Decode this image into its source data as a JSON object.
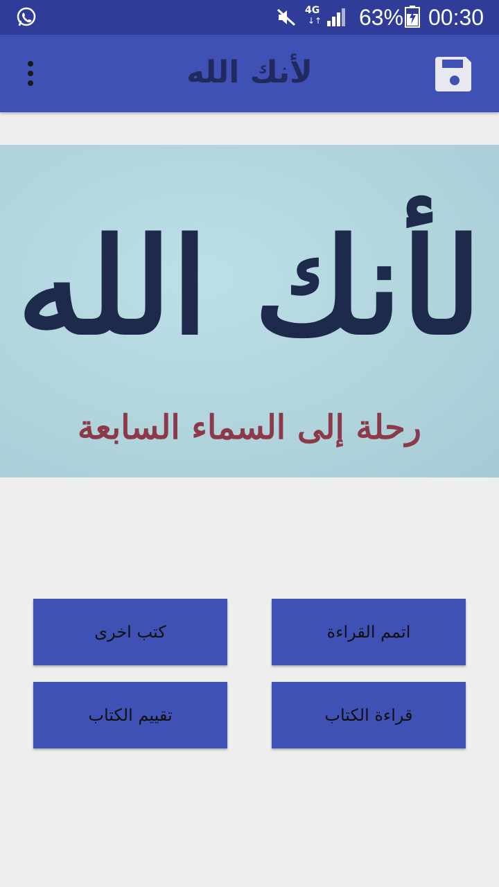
{
  "status_bar": {
    "network": "4G",
    "network_arrows": "↓↑",
    "battery_percent": "63%",
    "time": "00:30",
    "icons": [
      "whatsapp-icon",
      "mute-icon",
      "signal-icon",
      "battery-charging-icon"
    ]
  },
  "app_bar": {
    "title": "لأنك الله",
    "menu_icon": "more-vert-icon",
    "save_icon": "save-icon",
    "background": "#3f51b5"
  },
  "cover": {
    "title": "لأنك الله",
    "subtitle": "رحلة إلى السماء السابعة",
    "background": "#b3d6df",
    "title_color": "#1d2a4b",
    "subtitle_color": "#8c3a4a"
  },
  "buttons": {
    "finish_reading": "اتمم القراءة",
    "other_books": "كتب اخرى",
    "read_book": "قراءة الكتاب",
    "rate_book": "تقييم الكتاب"
  }
}
